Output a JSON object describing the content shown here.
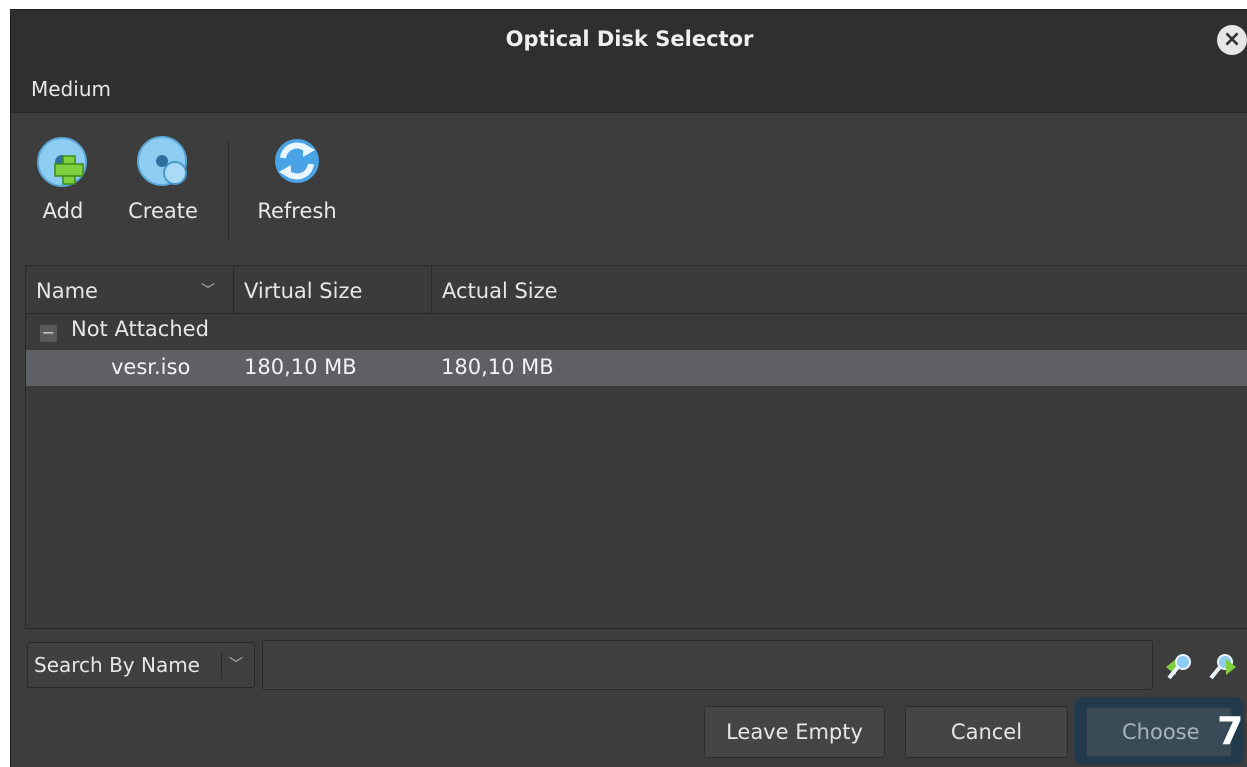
{
  "window": {
    "title": "Optical Disk Selector",
    "close_icon": "close-icon"
  },
  "menubar": {
    "items": [
      "Medium"
    ]
  },
  "toolbar": {
    "add_label": "Add",
    "create_label": "Create",
    "refresh_label": "Refresh"
  },
  "tree": {
    "columns": [
      "Name",
      "Virtual Size",
      "Actual Size"
    ],
    "sort_icon": "chevron-down-icon",
    "groups": [
      {
        "label": "Not Attached",
        "collapse_symbol": "−",
        "items": [
          {
            "name": "vesr.iso",
            "virtual_size": "180,10 MB",
            "actual_size": "180,10 MB",
            "selected": true
          }
        ]
      }
    ]
  },
  "search": {
    "mode_selected": "Search By Name",
    "value": "",
    "buttons": [
      "search-backward-icon",
      "search-forward-icon"
    ]
  },
  "buttons": {
    "leave_empty": "Leave Empty",
    "cancel": "Cancel",
    "choose": "Choose"
  },
  "annotation": {
    "badge": "7"
  },
  "colors": {
    "background": "#3d3d3d",
    "titlebar": "#2f2f2f",
    "selection": "#5e6066",
    "choose_highlight": "#223a4c"
  }
}
